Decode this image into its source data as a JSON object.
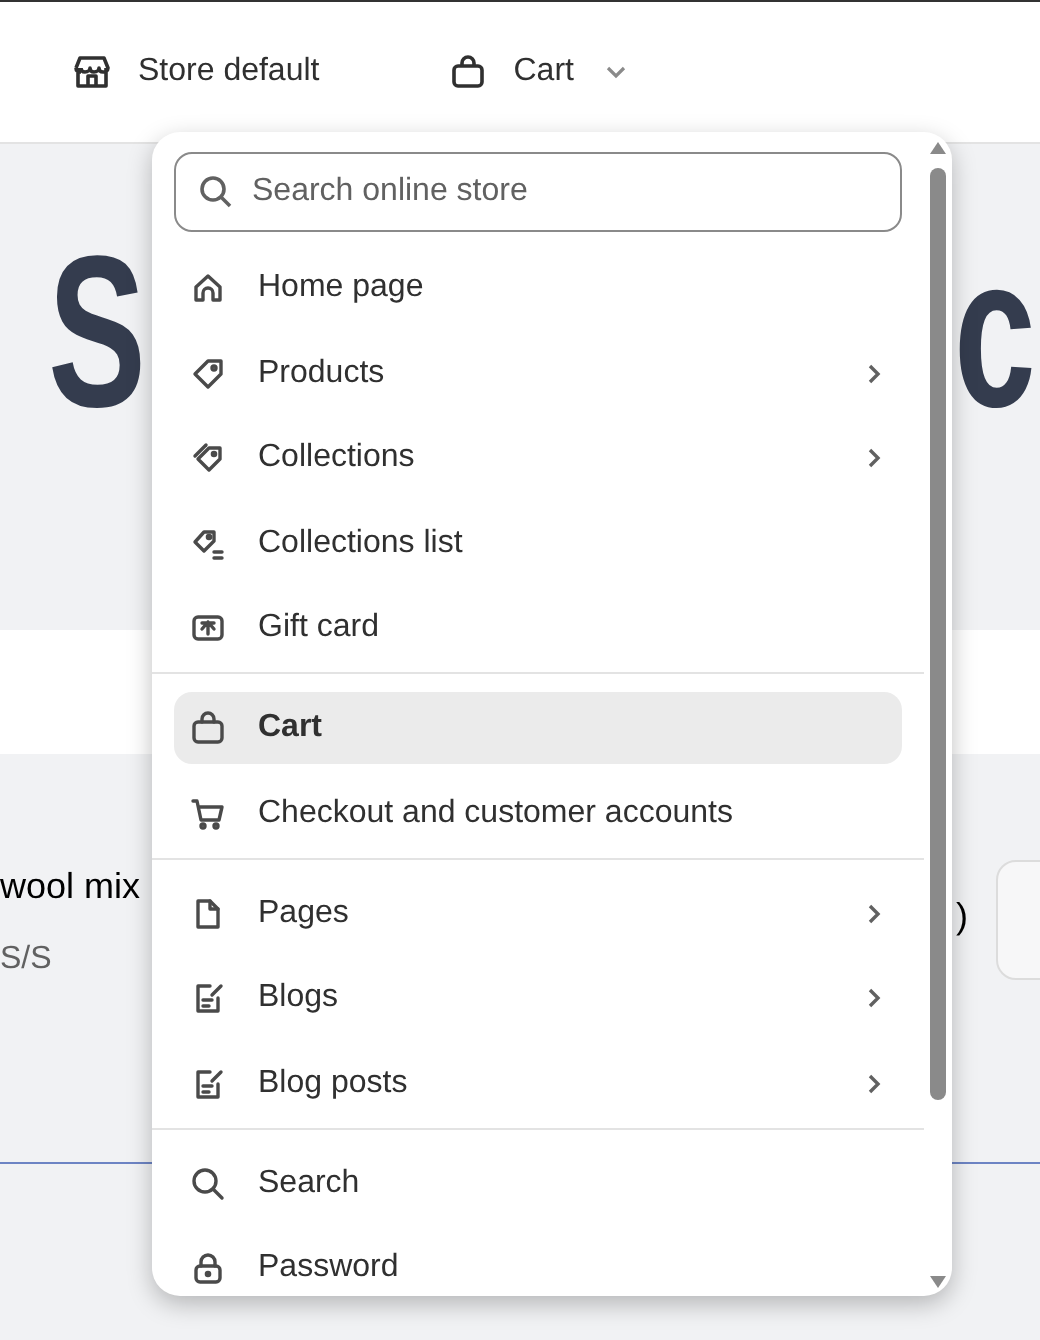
{
  "toolbar": {
    "store": "Store default",
    "template": "Cart"
  },
  "background": {
    "heading_start": "S",
    "heading_end": "c",
    "product_name": "wool mix",
    "product_meta": "S/S",
    "price_tail": ")"
  },
  "menu": {
    "search": {
      "placeholder": "Search online store"
    },
    "groups": [
      [
        {
          "label": "Home page",
          "submenu": false,
          "selected": false
        },
        {
          "label": "Products",
          "submenu": true,
          "selected": false
        },
        {
          "label": "Collections",
          "submenu": true,
          "selected": false
        },
        {
          "label": "Collections list",
          "submenu": false,
          "selected": false
        },
        {
          "label": "Gift card",
          "submenu": false,
          "selected": false
        }
      ],
      [
        {
          "label": "Cart",
          "submenu": false,
          "selected": true
        },
        {
          "label": "Checkout and customer accounts",
          "submenu": false,
          "selected": false
        }
      ],
      [
        {
          "label": "Pages",
          "submenu": true,
          "selected": false
        },
        {
          "label": "Blogs",
          "submenu": true,
          "selected": false
        },
        {
          "label": "Blog posts",
          "submenu": true,
          "selected": false
        }
      ],
      [
        {
          "label": "Search",
          "submenu": false,
          "selected": false
        },
        {
          "label": "Password",
          "submenu": false,
          "selected": false
        }
      ]
    ]
  }
}
